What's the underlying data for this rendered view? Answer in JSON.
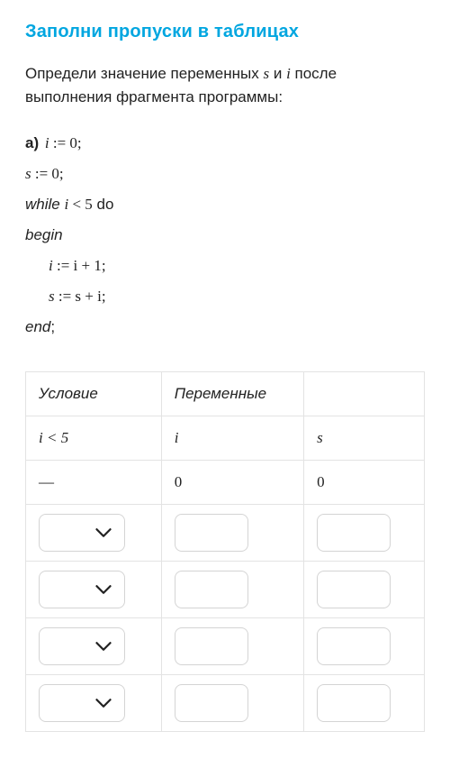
{
  "title": "Заполни пропуски в таблицах",
  "intro_prefix": "Определи значение переменных ",
  "intro_var_s": "s",
  "intro_and": " и ",
  "intro_var_i": "i",
  "intro_suffix": " после выполнения фрагмента программы:",
  "code": {
    "part_label": "a)",
    "l1_var": "i",
    "l1_assign": " := 0;",
    "l2_var": "s",
    "l2_assign": " := 0;",
    "l3_while": "while ",
    "l3_cond_var": "i",
    "l3_cond_rest": " < 5",
    "l3_do": " do",
    "l4_begin": "begin",
    "l5_lhs": "i",
    "l5_rhs": " := i + 1;",
    "l6_lhs": "s",
    "l6_rhs": " := s + i;",
    "l7_end": "end",
    "l7_semi": ";"
  },
  "table": {
    "head_cond": "Условие",
    "head_vars": "Переменные",
    "head_blank": "",
    "sub_cond_var": "i",
    "sub_cond_rest": " < 5",
    "sub_i": "i",
    "sub_s": "s",
    "row0": {
      "cond": "—",
      "i": "0",
      "s": "0"
    }
  }
}
